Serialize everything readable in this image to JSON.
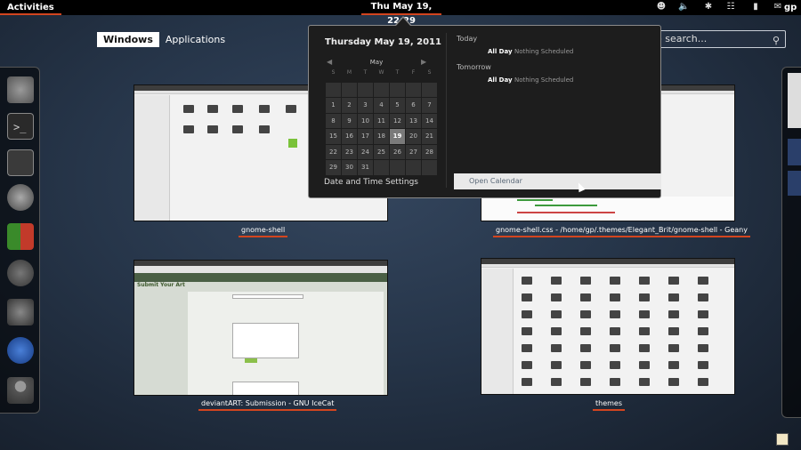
{
  "top_panel": {
    "activities_label": "Activities",
    "clock_label": "Thu May 19, 22:29",
    "tray_icons": [
      "accessibility-icon",
      "volume-icon",
      "bluetooth-icon",
      "network-icon",
      "power-icon",
      "chat-icon"
    ],
    "user_label": "gp"
  },
  "overview": {
    "tabs": [
      {
        "label": "Windows",
        "active": true
      },
      {
        "label": "Applications",
        "active": false
      }
    ],
    "search_placeholder": "o search..."
  },
  "calendar": {
    "date_heading": "Thursday May 19, 2011",
    "month_label": "May",
    "weekdays": [
      "S",
      "M",
      "T",
      "W",
      "T",
      "F",
      "S"
    ],
    "days": [
      "",
      "",
      "",
      "",
      "",
      "",
      "",
      "1",
      "2",
      "3",
      "4",
      "5",
      "6",
      "7",
      "8",
      "9",
      "10",
      "11",
      "12",
      "13",
      "14",
      "15",
      "16",
      "17",
      "18",
      "19",
      "20",
      "21",
      "22",
      "23",
      "24",
      "25",
      "26",
      "27",
      "28",
      "29",
      "30",
      "31",
      "",
      "",
      "",
      ""
    ],
    "today": "19",
    "date_time_settings_label": "Date and Time Settings",
    "events": [
      {
        "heading": "Today",
        "time": "All Day",
        "text": "Nothing Scheduled"
      },
      {
        "heading": "Tomorrow",
        "time": "All Day",
        "text": "Nothing Scheduled"
      }
    ],
    "open_calendar_label": "Open Calendar"
  },
  "windows": [
    {
      "caption": "gnome-shell"
    },
    {
      "caption": "gnome-shell.css - /home/gp/.themes/Elegant_Brit/gnome-shell - Geany"
    },
    {
      "caption": "deviantART: Submission - GNU IceCat",
      "page_title": "Submit Your Art"
    },
    {
      "caption": "themes"
    }
  ],
  "dash_icons": [
    "gimp-icon",
    "terminal-icon",
    "system-monitor-icon",
    "gnome-foot-icon",
    "package-icon",
    "refresh-icon",
    "email-icon",
    "icecat-icon",
    "user-icon"
  ],
  "accent_color": "#d3451f"
}
